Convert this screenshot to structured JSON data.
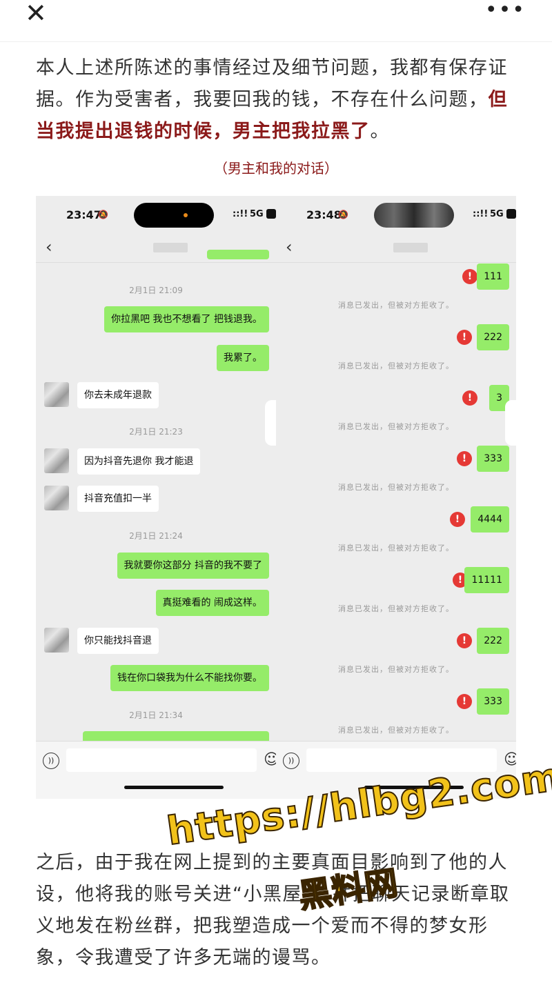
{
  "topbar": {
    "close_glyph": "✕",
    "more_glyph": "•••"
  },
  "article": {
    "p1_normal": "本人上述所陈述的事情经过及细节问题，我都有保存证据。作为受害者，我要回我的钱，不存在什么问题，",
    "p1_emph": "但当我提出退钱的时候，男主把我拉黑了",
    "p1_end": "。",
    "caption": "（男主和我的对话）",
    "p2": "之后，由于我在网上提到的主要真面目影响到了他的人设，他将我的账号关进“小黑屋”，并把聊天记录断章取义地发在粉丝群，把我塑造成一个爱而不得的梦女形象，令我遭受了许多无端的谩骂。"
  },
  "left_phone": {
    "time": "23:47",
    "signal": "::!!",
    "network": "5G",
    "items": [
      {
        "ts": "2月1日 21:09"
      },
      {
        "out": "你拉黑吧 我也不想看了 把钱退我。"
      },
      {
        "out": "我累了。"
      },
      {
        "in": "你去未成年退款"
      },
      {
        "ts": "2月1日 21:23"
      },
      {
        "in": "因为抖音先退你 我才能退"
      },
      {
        "in": "抖音充值扣一半"
      },
      {
        "ts": "2月1日 21:24"
      },
      {
        "out": "我就要你这部分 抖音的我不要了"
      },
      {
        "out": "真挺难看的 闹成这样。"
      },
      {
        "in": "你只能找抖音退"
      },
      {
        "out": "钱在你口袋我为什么不能找你要。"
      },
      {
        "ts": "2月1日 21:34"
      }
    ]
  },
  "right_phone": {
    "time": "23:48",
    "signal": "::!!",
    "network": "5G",
    "notice": "消息已发出，但被对方拒收了。",
    "messages": [
      "111",
      "222",
      "3",
      "333",
      "4444",
      "11111",
      "222",
      "333"
    ]
  },
  "watermark": {
    "url": "https://hlbg2.com",
    "name": "黑料网"
  },
  "colors": {
    "accent_red": "#8b1a1a",
    "wechat_green": "#95ec69",
    "error_red": "#e53935"
  }
}
